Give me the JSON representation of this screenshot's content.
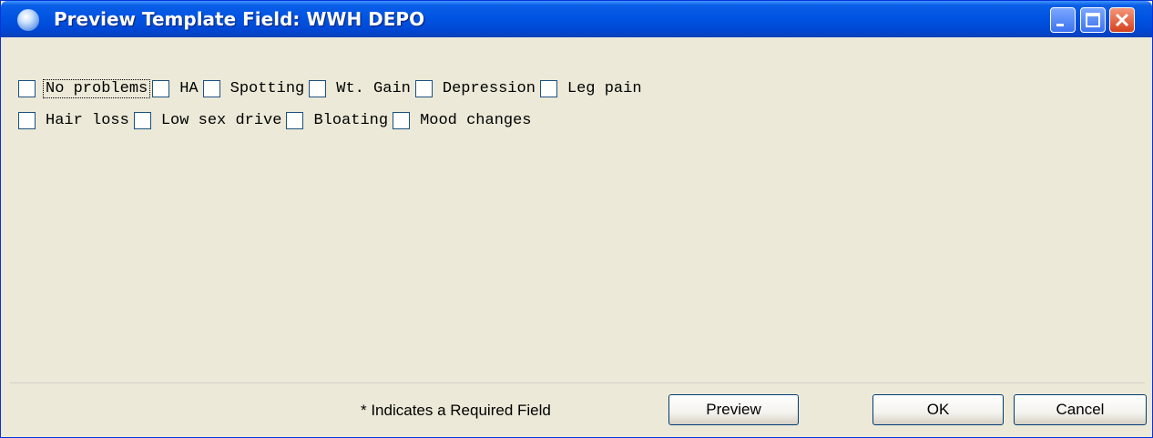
{
  "window": {
    "title": "Preview Template Field: WWH DEPO",
    "icon": "app-globe-icon"
  },
  "caption_buttons": {
    "minimize_icon": "minimize-icon",
    "maximize_icon": "maximize-icon",
    "close_icon": "close-icon"
  },
  "checkboxes": {
    "row1": [
      {
        "label": "No problems",
        "checked": false
      },
      {
        "label": "HA",
        "checked": false
      },
      {
        "label": "Spotting",
        "checked": false
      },
      {
        "label": "Wt. Gain",
        "checked": false
      },
      {
        "label": "Depression",
        "checked": false
      },
      {
        "label": "Leg pain",
        "checked": false
      }
    ],
    "row2": [
      {
        "label": "Hair loss",
        "checked": false
      },
      {
        "label": "Low sex drive",
        "checked": false
      },
      {
        "label": "Bloating",
        "checked": false
      },
      {
        "label": "Mood changes",
        "checked": false
      }
    ]
  },
  "footer": {
    "required_note": "* Indicates a Required Field",
    "preview_label": "Preview",
    "ok_label": "OK",
    "cancel_label": "Cancel"
  },
  "colors": {
    "titlebar": "#0054e3",
    "dialog_face": "#ece9d8",
    "close_button": "#d4421e"
  }
}
